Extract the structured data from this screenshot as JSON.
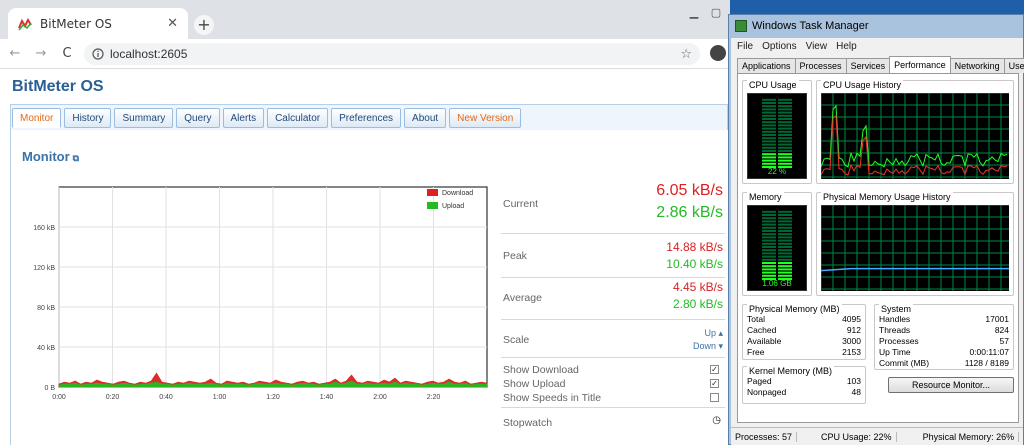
{
  "browser": {
    "tab_title": "BitMeter OS",
    "new_tab_symbol": "+",
    "url": "localhost:2605",
    "nav": {
      "back": "←",
      "forward": "→",
      "reload": "C"
    }
  },
  "app": {
    "brand": "BitMeter OS",
    "tabs": [
      {
        "label": "Monitor",
        "active": true
      },
      {
        "label": "History"
      },
      {
        "label": "Summary"
      },
      {
        "label": "Query"
      },
      {
        "label": "Alerts"
      },
      {
        "label": "Calculator"
      },
      {
        "label": "Preferences"
      },
      {
        "label": "About"
      },
      {
        "label": "New Version",
        "highlight": true
      }
    ],
    "monitor_title": "Monitor"
  },
  "chart_data": {
    "type": "area",
    "legend": [
      "Download",
      "Upload"
    ],
    "legend_position": "top-right",
    "x_ticks": [
      "0:00",
      "0:20",
      "0:40",
      "1:00",
      "1:20",
      "1:40",
      "2:00",
      "2:20"
    ],
    "x_tick_values": [
      0,
      20,
      40,
      60,
      80,
      100,
      120,
      140
    ],
    "y_ticks": [
      "0 B",
      "40 kB",
      "80 kB",
      "120 kB",
      "160 kB"
    ],
    "y_tick_values": [
      0,
      40,
      80,
      120,
      160
    ],
    "xlim": [
      0,
      160
    ],
    "ylim": [
      0,
      200
    ],
    "grid": true,
    "series": [
      {
        "name": "Download",
        "color": "#dd2020",
        "values": [
          3,
          5,
          4,
          6,
          3,
          5,
          4,
          7,
          5,
          4,
          3,
          5,
          6,
          4,
          3,
          5,
          4,
          6,
          14,
          5,
          4,
          3,
          5,
          4,
          6,
          5,
          4,
          5,
          8,
          4,
          3,
          6,
          5,
          4,
          5,
          3,
          4,
          6,
          5,
          4,
          7,
          5,
          4,
          3,
          5,
          6,
          4,
          5,
          3,
          4,
          5,
          8,
          4,
          6,
          12,
          5,
          4,
          6,
          5,
          4,
          7,
          5,
          9,
          4,
          6,
          5,
          4,
          3,
          5,
          6,
          4,
          5,
          8,
          5,
          4,
          6,
          3,
          4,
          5,
          4
        ]
      },
      {
        "name": "Upload",
        "color": "#22bb22",
        "values": [
          2,
          3,
          3,
          4,
          2,
          3,
          3,
          4,
          3,
          3,
          2,
          3,
          4,
          3,
          2,
          3,
          3,
          4,
          5,
          3,
          3,
          2,
          3,
          3,
          4,
          3,
          3,
          3,
          4,
          3,
          2,
          4,
          3,
          3,
          3,
          2,
          3,
          4,
          3,
          3,
          4,
          3,
          3,
          2,
          3,
          4,
          3,
          3,
          2,
          3,
          3,
          5,
          3,
          4,
          6,
          3,
          3,
          4,
          3,
          3,
          4,
          3,
          5,
          3,
          4,
          3,
          3,
          2,
          3,
          4,
          3,
          3,
          5,
          3,
          3,
          4,
          2,
          3,
          3,
          3
        ]
      }
    ]
  },
  "stats": {
    "current_label": "Current",
    "current_dl": "6.05 kB/s",
    "current_ul": "2.86 kB/s",
    "peak_label": "Peak",
    "peak_dl": "14.88 kB/s",
    "peak_ul": "10.40 kB/s",
    "average_label": "Average",
    "average_dl": "4.45 kB/s",
    "average_ul": "2.80 kB/s",
    "scale_label": "Scale",
    "scale_up": "Up",
    "scale_down": "Down",
    "options": [
      {
        "label": "Show Download",
        "checked": true
      },
      {
        "label": "Show Upload",
        "checked": true
      },
      {
        "label": "Show Speeds in Title",
        "checked": false
      }
    ],
    "stopwatch_label": "Stopwatch"
  },
  "taskmgr": {
    "title": "Windows Task Manager",
    "menu": [
      "File",
      "Options",
      "View",
      "Help"
    ],
    "tabs": [
      "Applications",
      "Processes",
      "Services",
      "Performance",
      "Networking",
      "Users"
    ],
    "active_tab": "Performance",
    "cpu_usage_label": "CPU Usage",
    "cpu_usage_value": "22 %",
    "cpu_usage_fraction": 0.22,
    "cpu_history_label": "CPU Usage History",
    "memory_label": "Memory",
    "memory_value": "1.06 GB",
    "memory_fraction": 0.26,
    "memory_history_label": "Physical Memory Usage History",
    "physical_memory": {
      "title": "Physical Memory (MB)",
      "rows": [
        [
          "Total",
          "4095"
        ],
        [
          "Cached",
          "912"
        ],
        [
          "Available",
          "3000"
        ],
        [
          "Free",
          "2153"
        ]
      ]
    },
    "kernel_memory": {
      "title": "Kernel Memory (MB)",
      "rows": [
        [
          "Paged",
          "103"
        ],
        [
          "Nonpaged",
          "48"
        ]
      ]
    },
    "system": {
      "title": "System",
      "rows": [
        [
          "Handles",
          "17001"
        ],
        [
          "Threads",
          "824"
        ],
        [
          "Processes",
          "57"
        ],
        [
          "Up Time",
          "0:00:11:07"
        ],
        [
          "Commit (MB)",
          "1128 / 8189"
        ]
      ]
    },
    "resource_button": "Resource Monitor...",
    "status": [
      "Processes: 57",
      "CPU Usage: 22%",
      "Physical Memory: 26%"
    ]
  }
}
